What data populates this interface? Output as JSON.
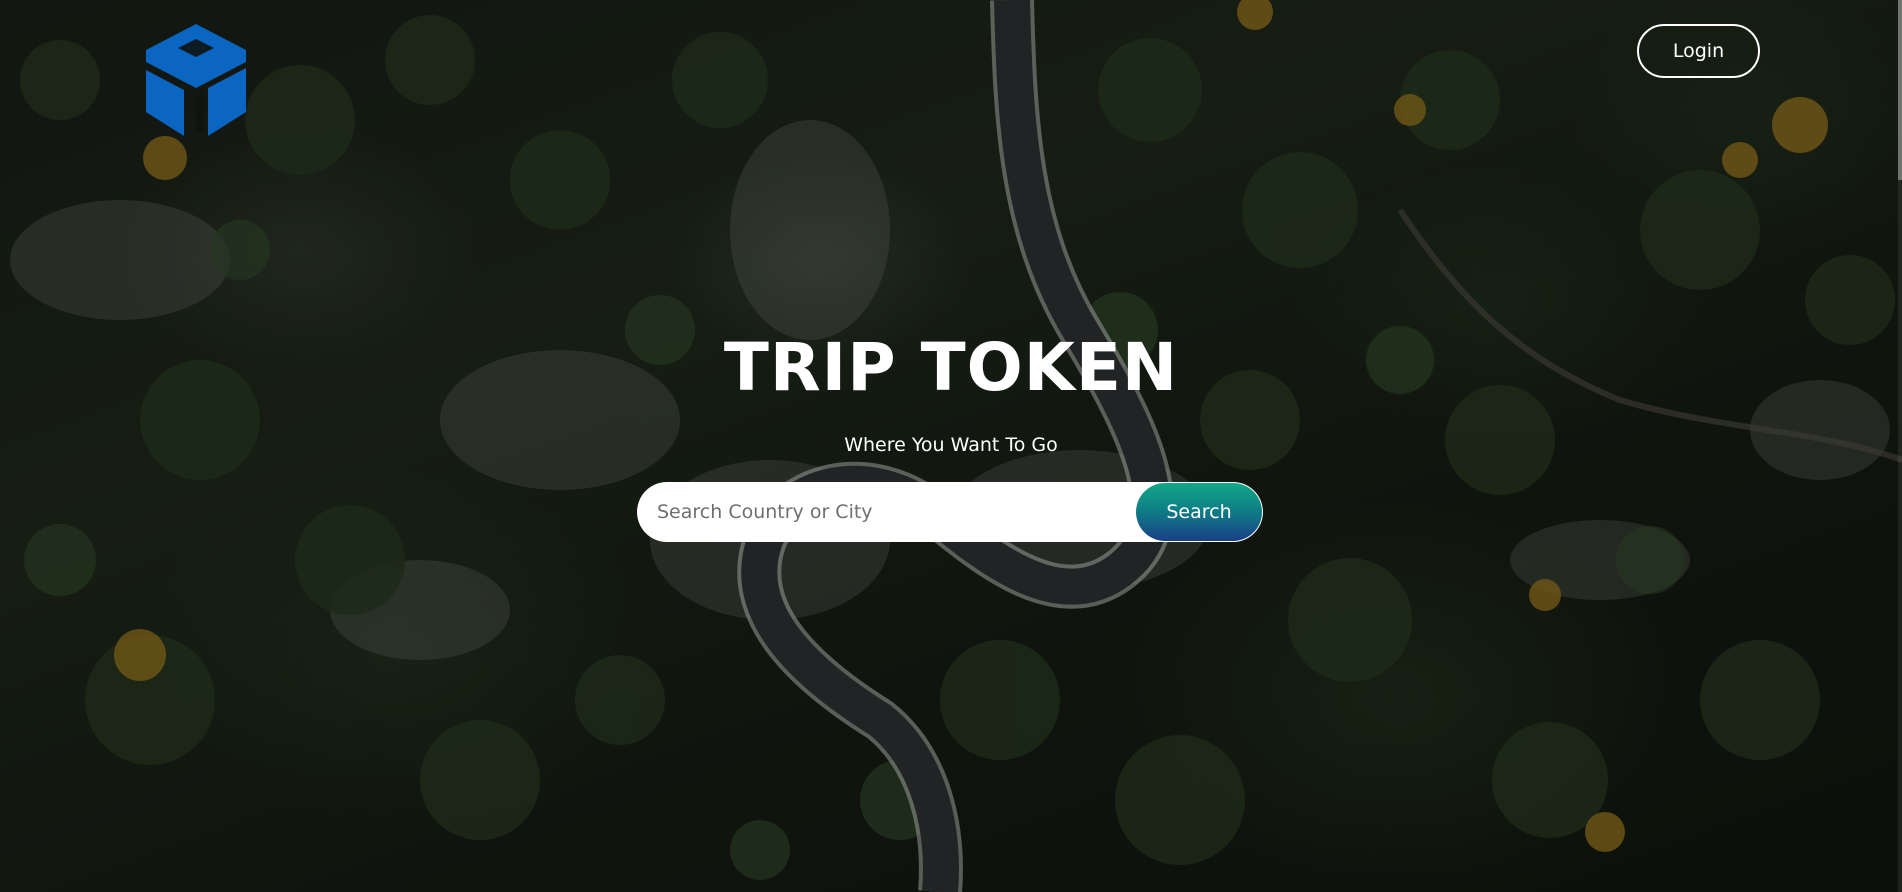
{
  "header": {
    "logo_icon": "cube-logo-icon",
    "login_label": "Login"
  },
  "hero": {
    "title": "TRIP TOKEN",
    "subtitle": "Where You Want To Go"
  },
  "search": {
    "placeholder": "Search Country or City",
    "value": "",
    "button_label": "Search",
    "icon": "search-icon"
  },
  "colors": {
    "logo": "#0a66c2",
    "search_button_top": "#12a886",
    "search_button_bottom": "#1a3f86",
    "text": "#ffffff"
  }
}
